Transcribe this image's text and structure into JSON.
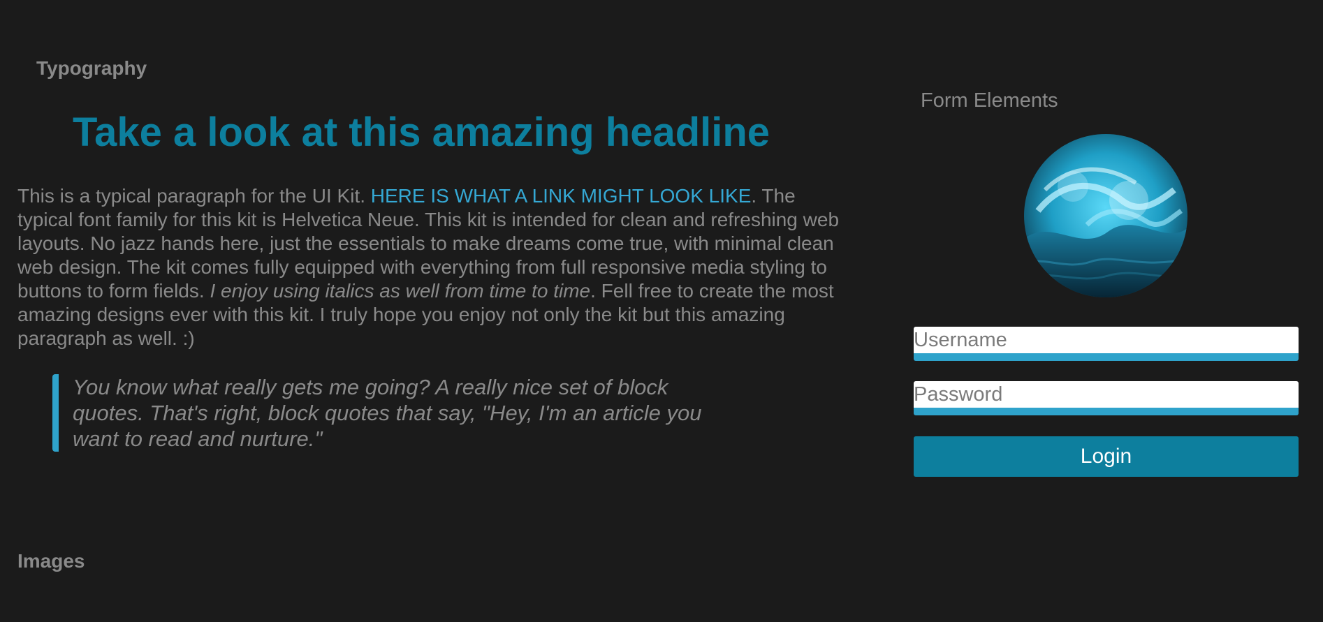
{
  "typography": {
    "section_title": "Typography",
    "headline": "Take a look at this amazing headline",
    "paragraph": {
      "part1": "This is a typical paragraph for the UI Kit. ",
      "link_text": "HERE IS WHAT A LINK MIGHT LOOK LIKE",
      "part2": ". The typical font family for this kit is Helvetica Neue. This kit is intended for clean and refreshing web layouts. No jazz hands here, just the essentials to make dreams come true, with minimal clean web design. The kit comes fully equipped with everything from full responsive media styling to buttons to form fields. ",
      "italic_text": "I enjoy using italics as well from time to time",
      "part3": ". Fell free to create the most amazing designs ever with this kit. I truly hope you enjoy not only the kit but this amazing paragraph as well. :)"
    },
    "blockquote": "You know what really gets me going? A really nice set of block quotes. That's right, block quotes that say, \"Hey, I'm an article you want to read and nurture.\""
  },
  "form": {
    "section_title": "Form Elements",
    "avatar_icon": "ocean-wave-image",
    "username_placeholder": "Username",
    "password_placeholder": "Password",
    "login_label": "Login"
  },
  "images": {
    "section_title": "Images"
  },
  "colors": {
    "background": "#1b1b1b",
    "accent": "#0d7f9e",
    "link": "#35a8d4",
    "text": "#8a8a8a"
  }
}
